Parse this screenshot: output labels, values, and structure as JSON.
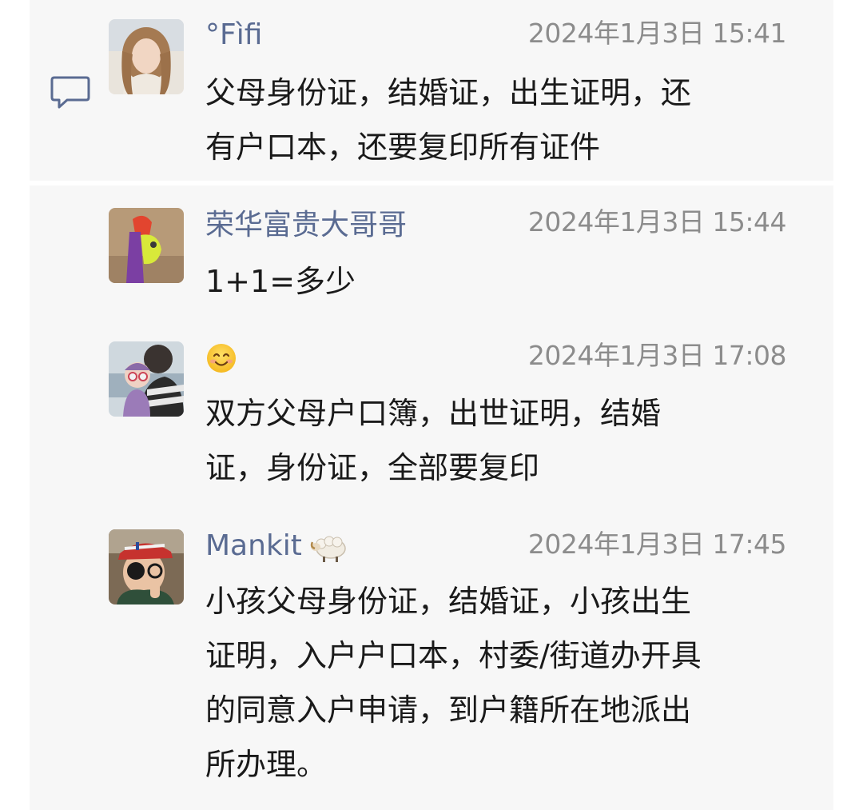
{
  "messages": [
    {
      "name": "°Fìfi",
      "time": "2024年1月3日 15:41",
      "text": "父母身份证，结婚证，出生证明，还\n有户口本，还要复印所有证件"
    },
    {
      "name": "荣华富贵大哥哥",
      "time": "2024年1月3日 15:44",
      "text": "1+1=多少"
    },
    {
      "name": "",
      "name_icon": "smiling-face-emoji",
      "time": "2024年1月3日 17:08",
      "text": "双方父母户口簿，出世证明，结婚\n证，身份证，全部要复印"
    },
    {
      "name": "Mankit",
      "name_icon": "sheep-emoji",
      "time": "2024年1月3日 17:45",
      "text": "小孩父母身份证，结婚证，小孩出生\n证明，入户户口本，村委/街道办开具\n的同意入户申请，到户籍所在地派出\n所办理。"
    }
  ],
  "icons": {
    "comment": "comment-bubble-icon"
  },
  "colors": {
    "name": "#5a6b92",
    "time": "#8c8c8c",
    "text": "#1a1a1a",
    "panel": "#f7f7f7"
  }
}
